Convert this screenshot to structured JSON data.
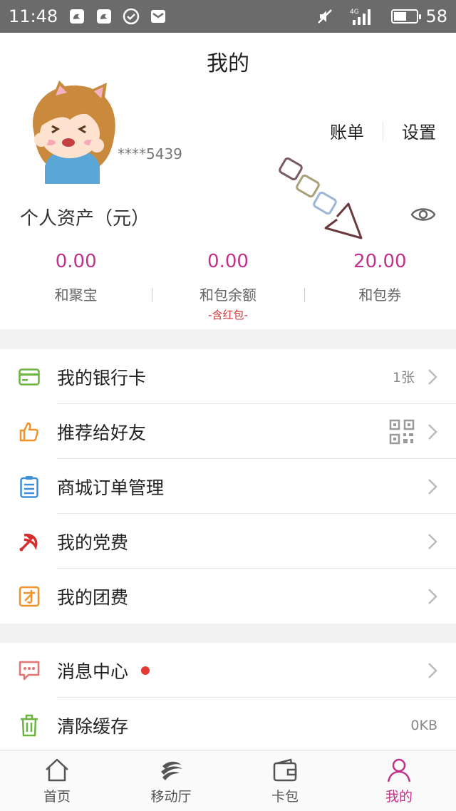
{
  "status_bar": {
    "time": "11:48",
    "network": "4G",
    "battery": "58",
    "battery_level": 0.58
  },
  "header": {
    "title": "我的",
    "phone_masked": "****5439",
    "bill_label": "账单",
    "settings_label": "设置"
  },
  "assets": {
    "title": "个人资产（元）",
    "items": [
      {
        "value": "0.00",
        "label": "和聚宝",
        "sub": ""
      },
      {
        "value": "0.00",
        "label": "和包余额",
        "sub": "-含红包-"
      },
      {
        "value": "20.00",
        "label": "和包券",
        "sub": ""
      }
    ]
  },
  "menu_group_1": [
    {
      "label": "我的银行卡",
      "value": "1张"
    },
    {
      "label": "推荐给好友",
      "value": ""
    },
    {
      "label": "商城订单管理",
      "value": ""
    },
    {
      "label": "我的党费",
      "value": ""
    },
    {
      "label": "我的团费",
      "value": ""
    }
  ],
  "menu_group_2": [
    {
      "label": "消息中心",
      "value": ""
    },
    {
      "label": "清除缓存",
      "value": "0KB"
    }
  ],
  "bottom_nav": [
    {
      "label": "首页",
      "icon": "home-icon"
    },
    {
      "label": "移动厅",
      "icon": "china-mobile-icon"
    },
    {
      "label": "卡包",
      "icon": "wallet-icon"
    },
    {
      "label": "我的",
      "icon": "profile-icon",
      "active": true
    }
  ],
  "colors": {
    "accent": "#c0338a",
    "status_bar": "#6b6b6b",
    "red": "#e53935"
  }
}
